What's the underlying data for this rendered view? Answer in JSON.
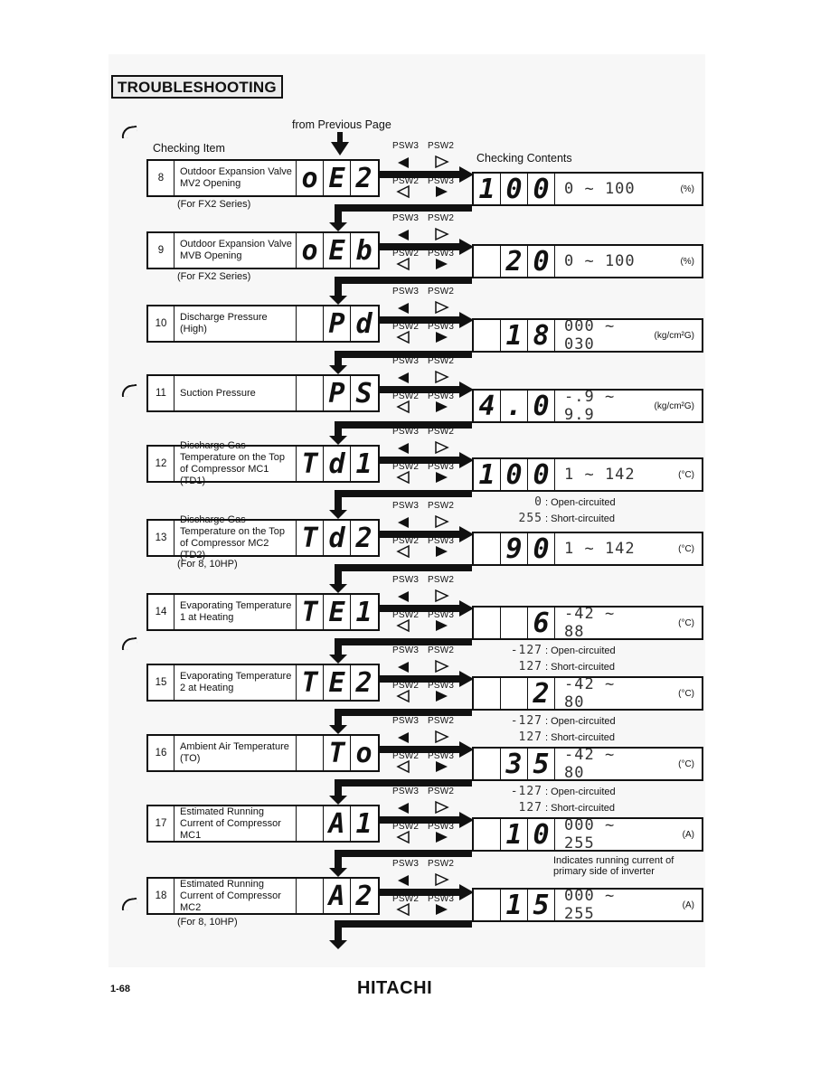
{
  "section_title": "TROUBLESHOOTING",
  "from_previous": "from Previous Page",
  "col_checking_item": "Checking Item",
  "col_checking_contents": "Checking Contents",
  "psw": {
    "a": "PSW3",
    "b": "PSW2"
  },
  "legend_text": {
    "open": ": Open-circuited",
    "short": ": Short-circuited"
  },
  "items": [
    {
      "num": "8",
      "label": "Outdoor Expansion Valve MV2 Opening",
      "code": [
        "o",
        "E",
        "2"
      ],
      "note": "(For FX2 Series)",
      "value": [
        "1",
        "0",
        "0"
      ],
      "range": "0 ~ 100",
      "unit": "(%)"
    },
    {
      "num": "9",
      "label": "Outdoor Expansion Valve MVB Opening",
      "code": [
        "o",
        "E",
        "b"
      ],
      "note": "(For FX2 Series)",
      "value": [
        "",
        "2",
        "0"
      ],
      "range": "0 ~ 100",
      "unit": "(%)"
    },
    {
      "num": "10",
      "label": "Discharge Pressure (High)",
      "code": [
        "",
        "P",
        "d"
      ],
      "note": "",
      "value": [
        "",
        "1",
        "8"
      ],
      "range": "000 ~ 030",
      "unit": "(kg/cm²G)"
    },
    {
      "num": "11",
      "label": "Suction Pressure",
      "code": [
        "",
        "P",
        "S"
      ],
      "note": "",
      "value": [
        "4",
        ".",
        "0"
      ],
      "range": "-.9 ~ 9.9",
      "unit": "(kg/cm²G)"
    },
    {
      "num": "12",
      "label": "Discharge Gas Temperature on the Top of Compressor MC1 (TD1)",
      "code": [
        "T",
        "d",
        "1"
      ],
      "note": "",
      "value": [
        "1",
        "0",
        "0"
      ],
      "range": "1 ~ 142",
      "unit": "(°C)",
      "legend": {
        "open": "0",
        "short": "255"
      }
    },
    {
      "num": "13",
      "label": "Discharge Gas Temperature on the Top of Compressor MC2 (TD2)",
      "code": [
        "T",
        "d",
        "2"
      ],
      "note": "(For 8, 10HP)",
      "value": [
        "",
        "9",
        "0"
      ],
      "range": "1 ~ 142",
      "unit": "(°C)"
    },
    {
      "num": "14",
      "label": "Evaporating Temperature 1 at Heating",
      "code": [
        "T",
        "E",
        "1"
      ],
      "note": "",
      "value": [
        "",
        "",
        "6"
      ],
      "range": "-42 ~ 88",
      "unit": "(°C)",
      "legend": {
        "open": "-127",
        "short": "127"
      }
    },
    {
      "num": "15",
      "label": "Evaporating Temperature 2 at Heating",
      "code": [
        "T",
        "E",
        "2"
      ],
      "note": "",
      "value": [
        "",
        "",
        "2"
      ],
      "range": "-42 ~ 80",
      "unit": "(°C)",
      "legend": {
        "open": "-127",
        "short": "127"
      }
    },
    {
      "num": "16",
      "label": "Ambient Air Temperature (TO)",
      "code": [
        "",
        "T",
        "o"
      ],
      "note": "",
      "value": [
        "",
        "3",
        "5"
      ],
      "range": "-42 ~ 80",
      "unit": "(°C)",
      "legend": {
        "open": "-127",
        "short": "127"
      }
    },
    {
      "num": "17",
      "label": "Estimated Running Current of Compressor MC1",
      "code": [
        "",
        "A",
        "1"
      ],
      "note": "",
      "value": [
        "",
        "1",
        "0"
      ],
      "range": "000 ~ 255",
      "unit": "(A)",
      "extra_note": "Indicates running current of primary side of inverter"
    },
    {
      "num": "18",
      "label": "Estimated Running Current of Compressor MC2",
      "code": [
        "",
        "A",
        "2"
      ],
      "note": "(For 8, 10HP)",
      "value": [
        "",
        "1",
        "5"
      ],
      "range": "000 ~ 255",
      "unit": "(A)"
    }
  ],
  "footer": {
    "page": "1-68",
    "brand": "HITACHI"
  }
}
